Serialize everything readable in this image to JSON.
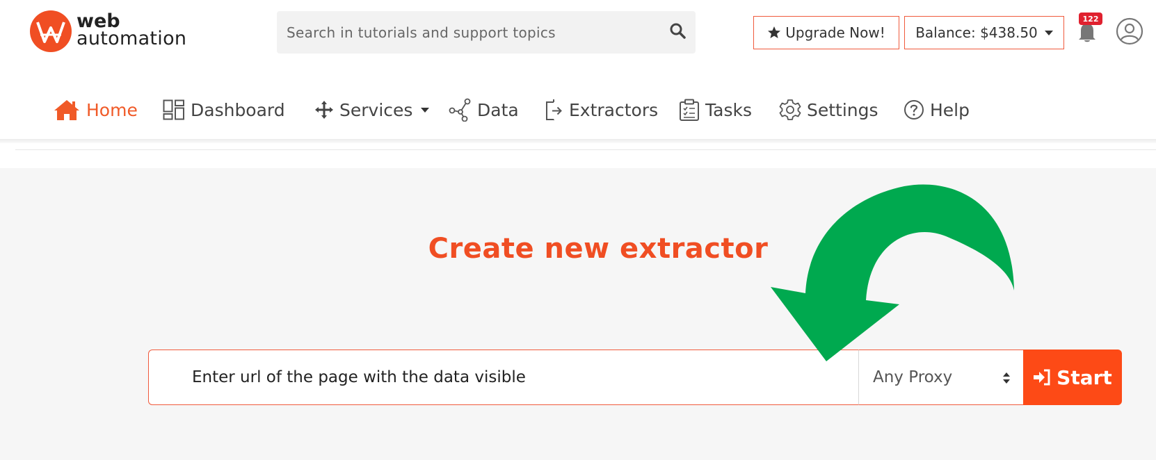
{
  "brand": {
    "name_line1": "web",
    "name_line2": "automation",
    "color": "#f04e23"
  },
  "search": {
    "placeholder": "Search in tutorials and support topics",
    "icon": "search-icon"
  },
  "header": {
    "upgrade_label": "Upgrade Now!",
    "balance_label": "Balance: $438.50",
    "notifications_count": "122"
  },
  "nav": {
    "items": [
      {
        "label": "Home",
        "icon": "home-icon",
        "active": true
      },
      {
        "label": "Dashboard",
        "icon": "dashboard-icon"
      },
      {
        "label": "Services",
        "icon": "move-icon",
        "dropdown": true
      },
      {
        "label": "Data",
        "icon": "nodes-icon"
      },
      {
        "label": "Extractors",
        "icon": "sign-out-icon"
      },
      {
        "label": "Tasks",
        "icon": "clipboard-icon"
      },
      {
        "label": "Settings",
        "icon": "gear-icon"
      },
      {
        "label": "Help",
        "icon": "help-icon"
      }
    ]
  },
  "main": {
    "heading": "Create new extractor",
    "url_placeholder": "Enter url of the page with the data visible",
    "proxy_selected": "Any Proxy",
    "start_label": "Start"
  },
  "colors": {
    "accent": "#fd4a16",
    "heading": "#f04e23",
    "arrow": "#00a94f"
  }
}
